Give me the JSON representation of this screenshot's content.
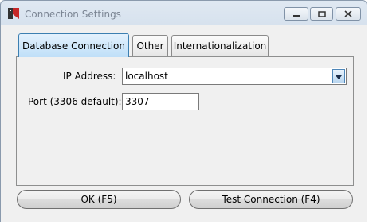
{
  "window": {
    "title": "Connection Settings"
  },
  "tabs": [
    {
      "label": "Database Connection",
      "active": true
    },
    {
      "label": "Other",
      "active": false
    },
    {
      "label": "Internationalization",
      "active": false
    }
  ],
  "form": {
    "ip_label": "IP Address:",
    "ip_value": "localhost",
    "port_label": "Port (3306 default):",
    "port_value": "3307"
  },
  "buttons": {
    "ok": "OK (F5)",
    "test": "Test Connection (F4)"
  },
  "icons": {
    "app": "app-icon",
    "minimize": "minimize-icon",
    "maximize": "maximize-icon",
    "close": "close-icon",
    "dropdown": "chevron-down-icon"
  },
  "colors": {
    "active_tab": "#bfdff8",
    "window_frame": "#8a9aad"
  }
}
